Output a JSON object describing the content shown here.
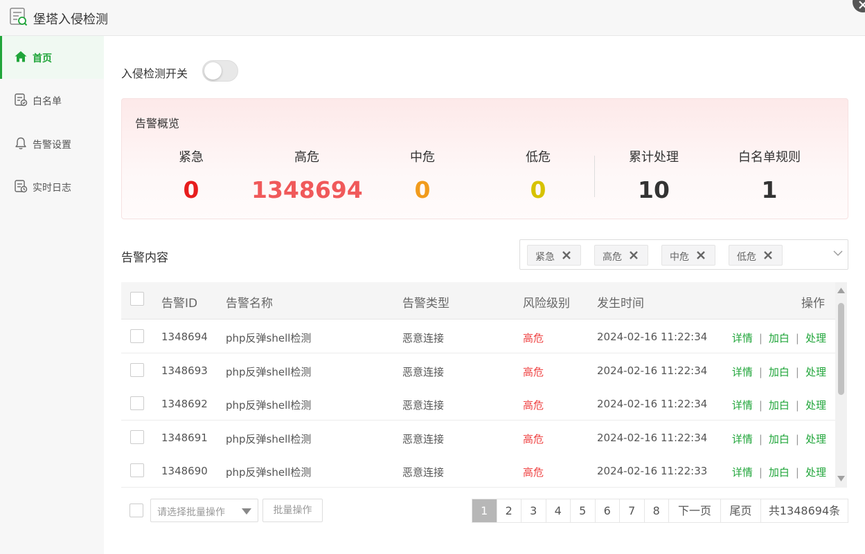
{
  "app": {
    "title": "堡塔入侵检测"
  },
  "sidebar": {
    "items": [
      {
        "label": "首页",
        "icon": "home-icon"
      },
      {
        "label": "白名单",
        "icon": "whitelist-icon"
      },
      {
        "label": "告警设置",
        "icon": "bell-icon"
      },
      {
        "label": "实时日志",
        "icon": "log-icon"
      }
    ]
  },
  "switch": {
    "label": "入侵检测开关",
    "on": false
  },
  "overview": {
    "title": "告警概览",
    "stats": [
      {
        "label": "紧急",
        "value": "0",
        "color": "#e71d1d"
      },
      {
        "label": "高危",
        "value": "1348694",
        "color": "#f0595a"
      },
      {
        "label": "中危",
        "value": "0",
        "color": "#f19b1c"
      },
      {
        "label": "低危",
        "value": "0",
        "color": "#d7c200"
      },
      {
        "label": "累计处理",
        "value": "10",
        "color": "#333333"
      },
      {
        "label": "白名单规则",
        "value": "1",
        "color": "#333333"
      }
    ]
  },
  "alerts": {
    "title": "告警内容",
    "filter_tags": [
      "紧急",
      "高危",
      "中危",
      "低危"
    ],
    "columns": {
      "id": "告警ID",
      "name": "告警名称",
      "type": "告警类型",
      "level": "风险级别",
      "time": "发生时间",
      "ops": "操作"
    },
    "ops": {
      "detail": "详情",
      "whitelist": "加白",
      "handle": "处理",
      "sep": "|"
    },
    "rows": [
      {
        "id": "1348694",
        "name": "php反弹shell检测",
        "type": "恶意连接",
        "level": "高危",
        "time": "2024-02-16 11:22:34"
      },
      {
        "id": "1348693",
        "name": "php反弹shell检测",
        "type": "恶意连接",
        "level": "高危",
        "time": "2024-02-16 11:22:34"
      },
      {
        "id": "1348692",
        "name": "php反弹shell检测",
        "type": "恶意连接",
        "level": "高危",
        "time": "2024-02-16 11:22:34"
      },
      {
        "id": "1348691",
        "name": "php反弹shell检测",
        "type": "恶意连接",
        "level": "高危",
        "time": "2024-02-16 11:22:34"
      },
      {
        "id": "1348690",
        "name": "php反弹shell检测",
        "type": "恶意连接",
        "level": "高危",
        "time": "2024-02-16 11:22:33"
      }
    ]
  },
  "footer": {
    "batch_placeholder": "请选择批量操作",
    "batch_button": "批量操作",
    "pages": [
      "1",
      "2",
      "3",
      "4",
      "5",
      "6",
      "7",
      "8"
    ],
    "active_page": "1",
    "next": "下一页",
    "last": "尾页",
    "total": "共1348694条"
  },
  "colors": {
    "accent": "#20a53a",
    "danger": "#ef4343"
  }
}
